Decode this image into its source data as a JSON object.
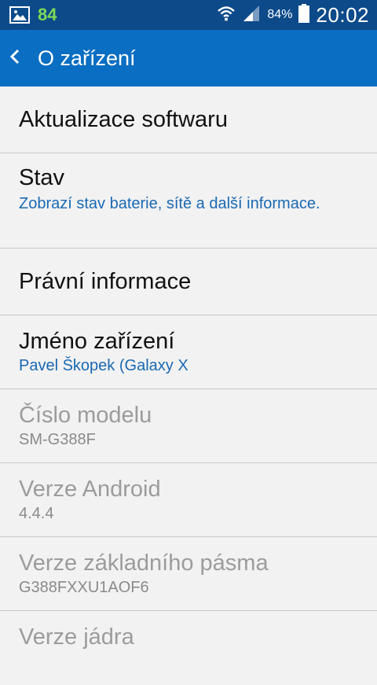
{
  "status_bar": {
    "notification_count": "84",
    "battery_percent": "84%",
    "time": "20:02"
  },
  "action_bar": {
    "title": "O zařízení"
  },
  "settings": [
    {
      "title": "Aktualizace softwaru",
      "subtitle": null,
      "enabled": true
    },
    {
      "title": "Stav",
      "subtitle": "Zobrazí stav baterie, sítě a další informace.",
      "enabled": true
    },
    {
      "title": "Právní informace",
      "subtitle": null,
      "enabled": true
    },
    {
      "title": "Jméno zařízení",
      "subtitle": "Pavel Škopek (Galaxy X",
      "enabled": true
    },
    {
      "title": "Číslo modelu",
      "subtitle": "SM-G388F",
      "enabled": false
    },
    {
      "title": "Verze Android",
      "subtitle": "4.4.4",
      "enabled": false
    },
    {
      "title": "Verze základního pásma",
      "subtitle": "G388FXXU1AOF6",
      "enabled": false
    },
    {
      "title": "Verze jádra",
      "subtitle": null,
      "enabled": false
    }
  ],
  "colors": {
    "status_bar_bg": "#0c4a8a",
    "action_bar_bg": "#0a6ec2",
    "accent_text": "#1a69b3",
    "disabled_text": "#9c9c9c"
  },
  "icons": [
    "image-notification-icon",
    "wifi-icon",
    "signal-icon",
    "battery-icon",
    "back-arrow-icon"
  ]
}
